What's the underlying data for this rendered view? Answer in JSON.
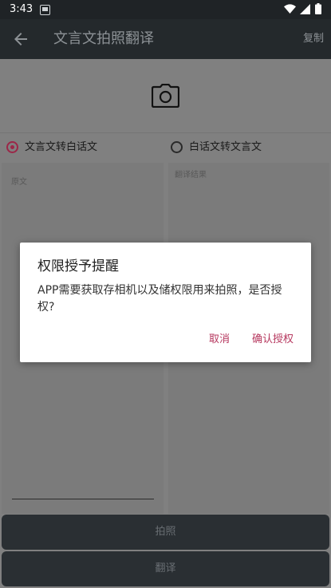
{
  "status_bar": {
    "time": "3:43",
    "notification_icon": "a-icon",
    "icons": [
      "wifi-icon",
      "signal-icon",
      "battery-icon"
    ]
  },
  "app_bar": {
    "back_icon": "arrow-left-icon",
    "title": "文言文拍照翻译",
    "action": "复制"
  },
  "camera": {
    "icon": "camera-icon"
  },
  "options": [
    {
      "label": "文言文转白话文",
      "selected": true
    },
    {
      "label": "白话文转文言文",
      "selected": false
    }
  ],
  "source_panel": {
    "placeholder": "原文"
  },
  "result_panel": {
    "placeholder": "翻译结果"
  },
  "buttons": {
    "photo": "拍照",
    "translate": "翻译"
  },
  "dialog": {
    "title": "权限授予提醒",
    "message": "APP需要获取存相机以及储权限用来拍照，是否授权?",
    "cancel": "取消",
    "confirm": "确认授权"
  },
  "colors": {
    "accent": "#b6375e",
    "appbar": "#24292c",
    "statusbar": "#1f2326"
  }
}
